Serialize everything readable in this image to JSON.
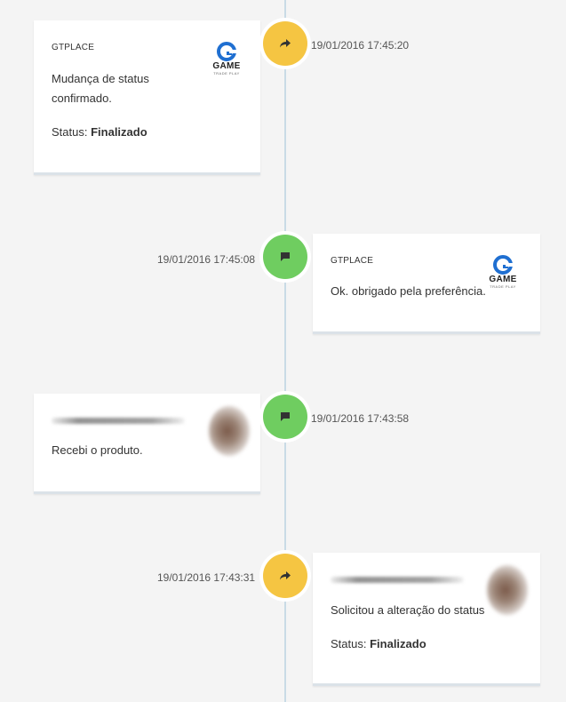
{
  "events": [
    {
      "author": "GTPLACE",
      "message": "Mudança de status confirmado.",
      "status_label": "Status:",
      "status_value": "Finalizado",
      "time": "19/01/2016 17:45:20",
      "type": "status-change",
      "node_color": "#f5c542",
      "icon": "share-arrow-icon",
      "logo": {
        "word": "GAME",
        "tag": "TRADE PLAY"
      }
    },
    {
      "author": "GTPLACE",
      "message": "Ok. obrigado pela preferência.",
      "time": "19/01/2016 17:45:08",
      "type": "comment",
      "node_color": "#6fcd60",
      "icon": "comment-icon",
      "logo": {
        "word": "GAME",
        "tag": "TRADE PLAY"
      }
    },
    {
      "message": "Recebi o produto.",
      "time": "19/01/2016 17:43:58",
      "type": "comment",
      "node_color": "#6fcd60",
      "icon": "comment-icon"
    },
    {
      "message": "Solicitou a alteração do status",
      "status_label": "Status:",
      "status_value": "Finalizado",
      "time": "19/01/2016 17:43:31",
      "type": "status-change",
      "node_color": "#f5c542",
      "icon": "share-arrow-icon"
    }
  ]
}
